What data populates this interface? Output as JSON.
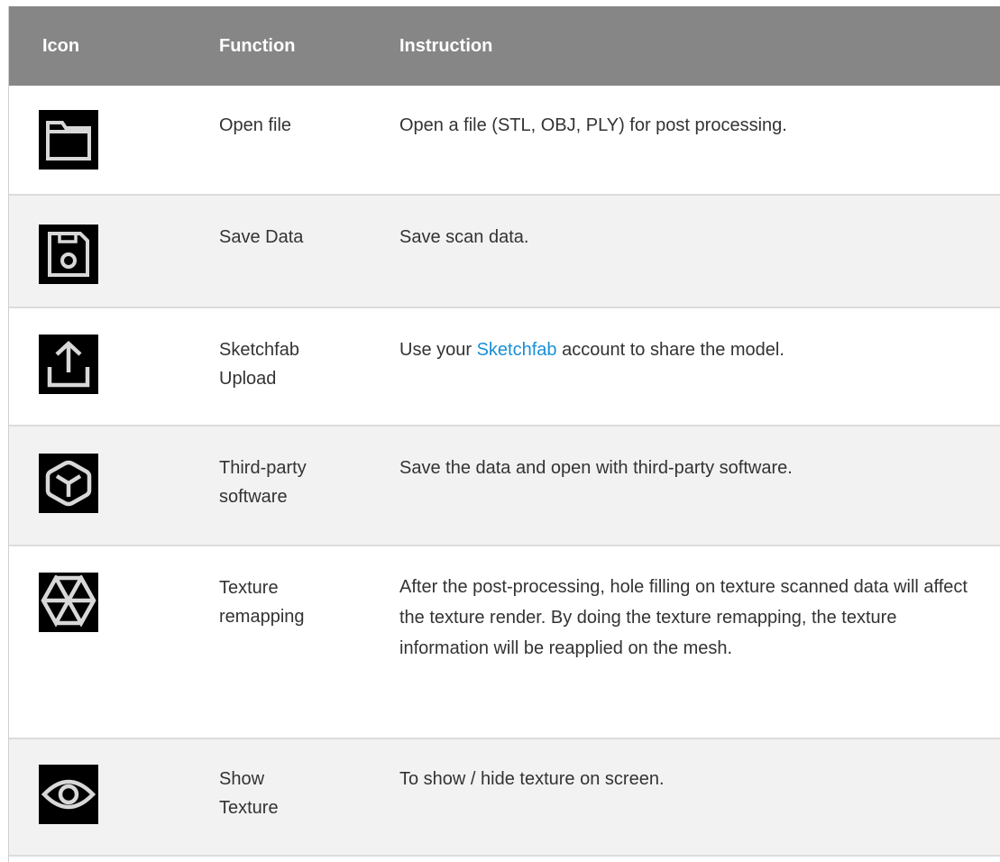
{
  "headers": {
    "icon": "Icon",
    "function": "Function",
    "instruction": "Instruction"
  },
  "rows": [
    {
      "icon": "folder-icon",
      "function": "Open file",
      "instruction": "Open a file (STL, OBJ, PLY) for post processing."
    },
    {
      "icon": "floppy-disk-icon",
      "function": "Save Data",
      "instruction": "Save scan data."
    },
    {
      "icon": "upload-icon",
      "function_line1": "Sketchfab",
      "function_line2": "Upload",
      "instruction_before": "Use your ",
      "instruction_link": "Sketchfab",
      "instruction_after": " account to share the model."
    },
    {
      "icon": "cube-icon",
      "function_line1": "Third-party",
      "function_line2": "software",
      "instruction": "Save the data and open with third-party software."
    },
    {
      "icon": "texture-remap-icon",
      "function_line1": "Texture",
      "function_line2": "remapping",
      "instruction": "After the post-processing, hole filling on texture scanned data will affect the texture render. By doing the texture remapping, the texture information will be reapplied on the mesh."
    },
    {
      "icon": "eye-icon",
      "function_line1": "Show",
      "function_line2": "Texture",
      "instruction": "To show / hide texture on screen."
    }
  ],
  "colors": {
    "header_bg": "#868686",
    "header_text": "#ffffff",
    "row_alt_bg": "#f2f2f2",
    "link": "#1a8fd6"
  }
}
